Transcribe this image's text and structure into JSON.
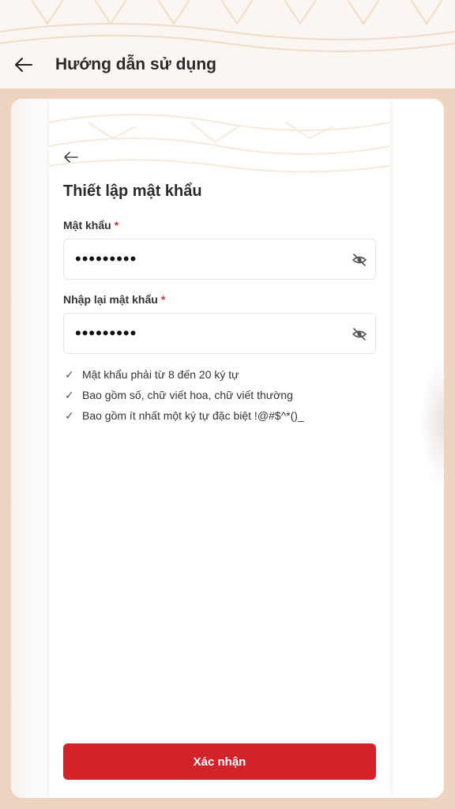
{
  "header": {
    "title": "Hướng dẫn sử dụng",
    "back_icon": "arrow-left-icon"
  },
  "phone_screen": {
    "back_icon": "arrow-left-icon",
    "title": "Thiết lập mật khẩu",
    "fields": [
      {
        "label": "Mật khẩu",
        "required_mark": "*",
        "value": "•••••••••",
        "icon": "eye-off-icon"
      },
      {
        "label": "Nhập lại mật khẩu",
        "required_mark": "*",
        "value": "•••••••••",
        "icon": "eye-off-icon"
      }
    ],
    "rules": [
      {
        "check": "✓",
        "text": "Mật khẩu phải từ 8 đến 20 ký tự"
      },
      {
        "check": "✓",
        "text": "Bao gồm số, chữ viết hoa, chữ viết thường"
      },
      {
        "check": "✓",
        "text": "Bao gồm ít nhất một ký tự đặc biệt !@#$^*()_"
      }
    ],
    "submit_label": "Xác nhận"
  },
  "colors": {
    "background": "#ecd4c0",
    "header_bg": "#fbf6f1",
    "accent_red": "#d2232a",
    "required_red": "#d32f2f"
  }
}
